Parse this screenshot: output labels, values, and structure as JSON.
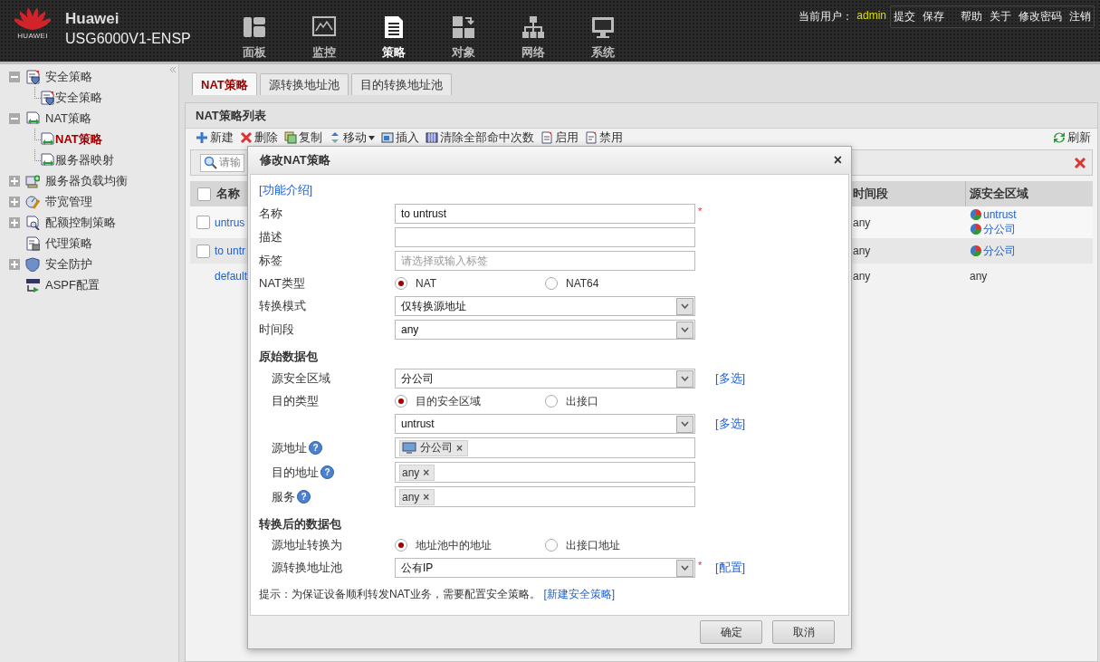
{
  "header": {
    "brand": "HUAWEI",
    "title": "Huawei",
    "model": "USG6000V1-ENSP",
    "nav": [
      {
        "label": "面板",
        "kind": "dashboard",
        "selected": false
      },
      {
        "label": "监控",
        "kind": "monitor",
        "selected": false
      },
      {
        "label": "策略",
        "kind": "policy",
        "selected": true
      },
      {
        "label": "对象",
        "kind": "object",
        "selected": false
      },
      {
        "label": "网络",
        "kind": "network",
        "selected": false
      },
      {
        "label": "系统",
        "kind": "system",
        "selected": false
      }
    ],
    "user_label": "当前用户：",
    "user": "admin",
    "links": [
      [
        "提交",
        "保存"
      ],
      [
        "帮助",
        "关于",
        "修改密码",
        "注销"
      ]
    ]
  },
  "sidebar": {
    "items": [
      {
        "label": "安全策略",
        "kind": "policy",
        "expanded": true,
        "selected": false,
        "children": [
          {
            "label": "安全策略",
            "kind": "policy",
            "selected": false
          }
        ]
      },
      {
        "label": "NAT策略",
        "kind": "nat",
        "expanded": true,
        "selected": false,
        "children": [
          {
            "label": "NAT策略",
            "kind": "nat",
            "selected": true
          },
          {
            "label": "服务器映射",
            "kind": "nat",
            "selected": false
          }
        ]
      },
      {
        "label": "服务器负载均衡",
        "kind": "server",
        "expanded": false,
        "selected": false
      },
      {
        "label": "带宽管理",
        "kind": "bandwidth",
        "expanded": false,
        "selected": false
      },
      {
        "label": "配额控制策略",
        "kind": "quota",
        "expanded": false,
        "selected": false
      },
      {
        "label": "代理策略",
        "kind": "proxy",
        "selected": false
      },
      {
        "label": "安全防护",
        "kind": "shield",
        "expanded": false,
        "selected": false
      },
      {
        "label": "ASPF配置",
        "kind": "aspf",
        "selected": false
      }
    ]
  },
  "tabs": [
    {
      "label": "NAT策略",
      "selected": true
    },
    {
      "label": "源转换地址池",
      "selected": false
    },
    {
      "label": "目的转换地址池",
      "selected": false
    }
  ],
  "panel": {
    "title": "NAT策略列表",
    "toolbar": [
      {
        "label": "新建",
        "kind": "add"
      },
      {
        "label": "删除",
        "kind": "delete"
      },
      {
        "label": "复制",
        "kind": "copy"
      },
      {
        "label": "移动",
        "kind": "move"
      },
      {
        "label": "插入",
        "kind": "insert"
      },
      {
        "label": "清除全部命中次数",
        "kind": "clear"
      },
      {
        "label": "启用",
        "kind": "enable"
      },
      {
        "label": "禁用",
        "kind": "disable"
      }
    ],
    "refresh": "刷新",
    "search": {
      "placeholder": "请输"
    },
    "table": {
      "columns": [
        "名称",
        "时间段",
        "源安全区域"
      ],
      "header_checked": false,
      "rows": [
        {
          "checked": false,
          "name": "untrus",
          "time": "any",
          "zones": [
            {
              "label": "untrust",
              "kind": "zone"
            },
            {
              "label": "分公司",
              "kind": "zone"
            }
          ]
        },
        {
          "checked": false,
          "name": "to untr",
          "time": "any",
          "zones": [
            {
              "label": "分公司",
              "kind": "zone"
            }
          ]
        },
        {
          "name": "default",
          "time": "any",
          "zones": [
            {
              "label": "any",
              "kind": "text"
            }
          ]
        }
      ]
    }
  },
  "dialog": {
    "title": "修改NAT策略",
    "close": "×",
    "help_link": "[功能介绍]",
    "fields": [
      {
        "kind": "text",
        "label": "名称",
        "value": "to untrust",
        "required_mark": "*"
      },
      {
        "kind": "text",
        "label": "描述"
      },
      {
        "kind": "text",
        "label": "标签",
        "placeholder": "请选择或输入标签"
      },
      {
        "kind": "radio",
        "label": "NAT类型",
        "options": [
          {
            "label": "NAT",
            "selected": true
          },
          {
            "label": "NAT64",
            "selected": false
          }
        ]
      },
      {
        "kind": "select",
        "label": "转换模式",
        "value": "仅转换源地址"
      },
      {
        "kind": "select",
        "label": "时间段",
        "value": "any"
      }
    ],
    "sections": [
      {
        "title": "原始数据包",
        "fields": [
          {
            "kind": "select",
            "label": "源安全区域",
            "value": "分公司",
            "link": "[多选]"
          },
          {
            "kind": "radio",
            "label": "目的类型",
            "options": [
              {
                "label": "目的安全区域",
                "selected": true
              },
              {
                "label": "出接口",
                "selected": false
              }
            ]
          },
          {
            "kind": "select",
            "value": "untrust",
            "link": "[多选]"
          },
          {
            "kind": "tags",
            "label": "源地址",
            "help": "?",
            "tags": [
              {
                "label": "分公司",
                "kind": "host",
                "remove": "×"
              }
            ]
          },
          {
            "kind": "tags",
            "label": "目的地址",
            "help": "?",
            "tags": [
              {
                "label": "any",
                "kind": "text",
                "remove": "×"
              }
            ]
          },
          {
            "kind": "tags",
            "label": "服务",
            "help": "?",
            "tags": [
              {
                "label": "any",
                "kind": "text",
                "remove": "×"
              }
            ]
          }
        ]
      },
      {
        "title": "转换后的数据包",
        "fields": [
          {
            "kind": "radio",
            "label": "源地址转换为",
            "options": [
              {
                "label": "地址池中的地址",
                "selected": true
              },
              {
                "label": "出接口地址",
                "selected": false
              }
            ]
          },
          {
            "kind": "select",
            "label": "源转换地址池",
            "value": "公有IP",
            "required_mark": "*",
            "link": "[配置]"
          }
        ]
      }
    ],
    "hint": "提示：为保证设备顺利转发NAT业务，需要配置安全策略。",
    "hint_link": "[新建安全策略]",
    "buttons": [
      "确定",
      "取消"
    ]
  }
}
